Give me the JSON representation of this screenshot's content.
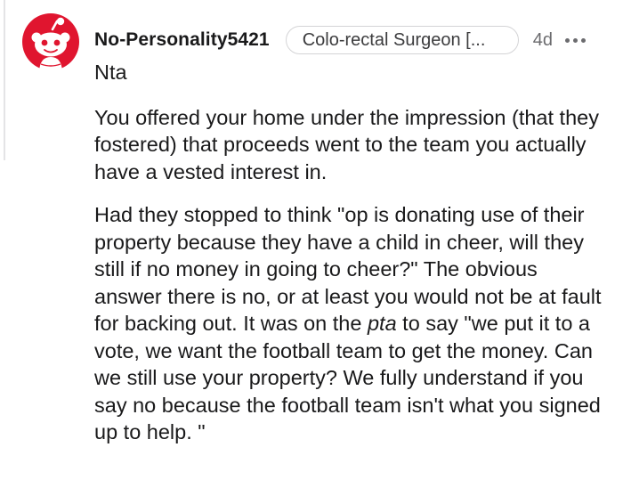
{
  "comment": {
    "username": "No-Personality5421",
    "flair": "Colo-rectal Surgeon [...",
    "age": "4d",
    "more_icon": "more-options-icon",
    "avatar_icon": "reddit-snoo-avatar-icon",
    "paragraphs": [
      "Nta",
      "You offered your home under the impression (that they fostered) that proceeds went to the team you actually have a vested interest in."
    ],
    "last_paragraph": {
      "before": "Had they stopped to think \"op is donating use of their property because they have a child in cheer, will they still if no money in going to cheer?\" The obvious answer there is no, or at least you would not be at fault for backing out. It was on the ",
      "emphasis": "pta",
      "after": " to say \"we put it to a vote, we want the football team to get the money. Can we still use your property? We fully understand if you say no because the football team isn't what you signed up to help. \""
    }
  },
  "colors": {
    "avatar_red": "#e0152f",
    "text": "#1a1a1b",
    "muted": "#6b6b6e"
  }
}
